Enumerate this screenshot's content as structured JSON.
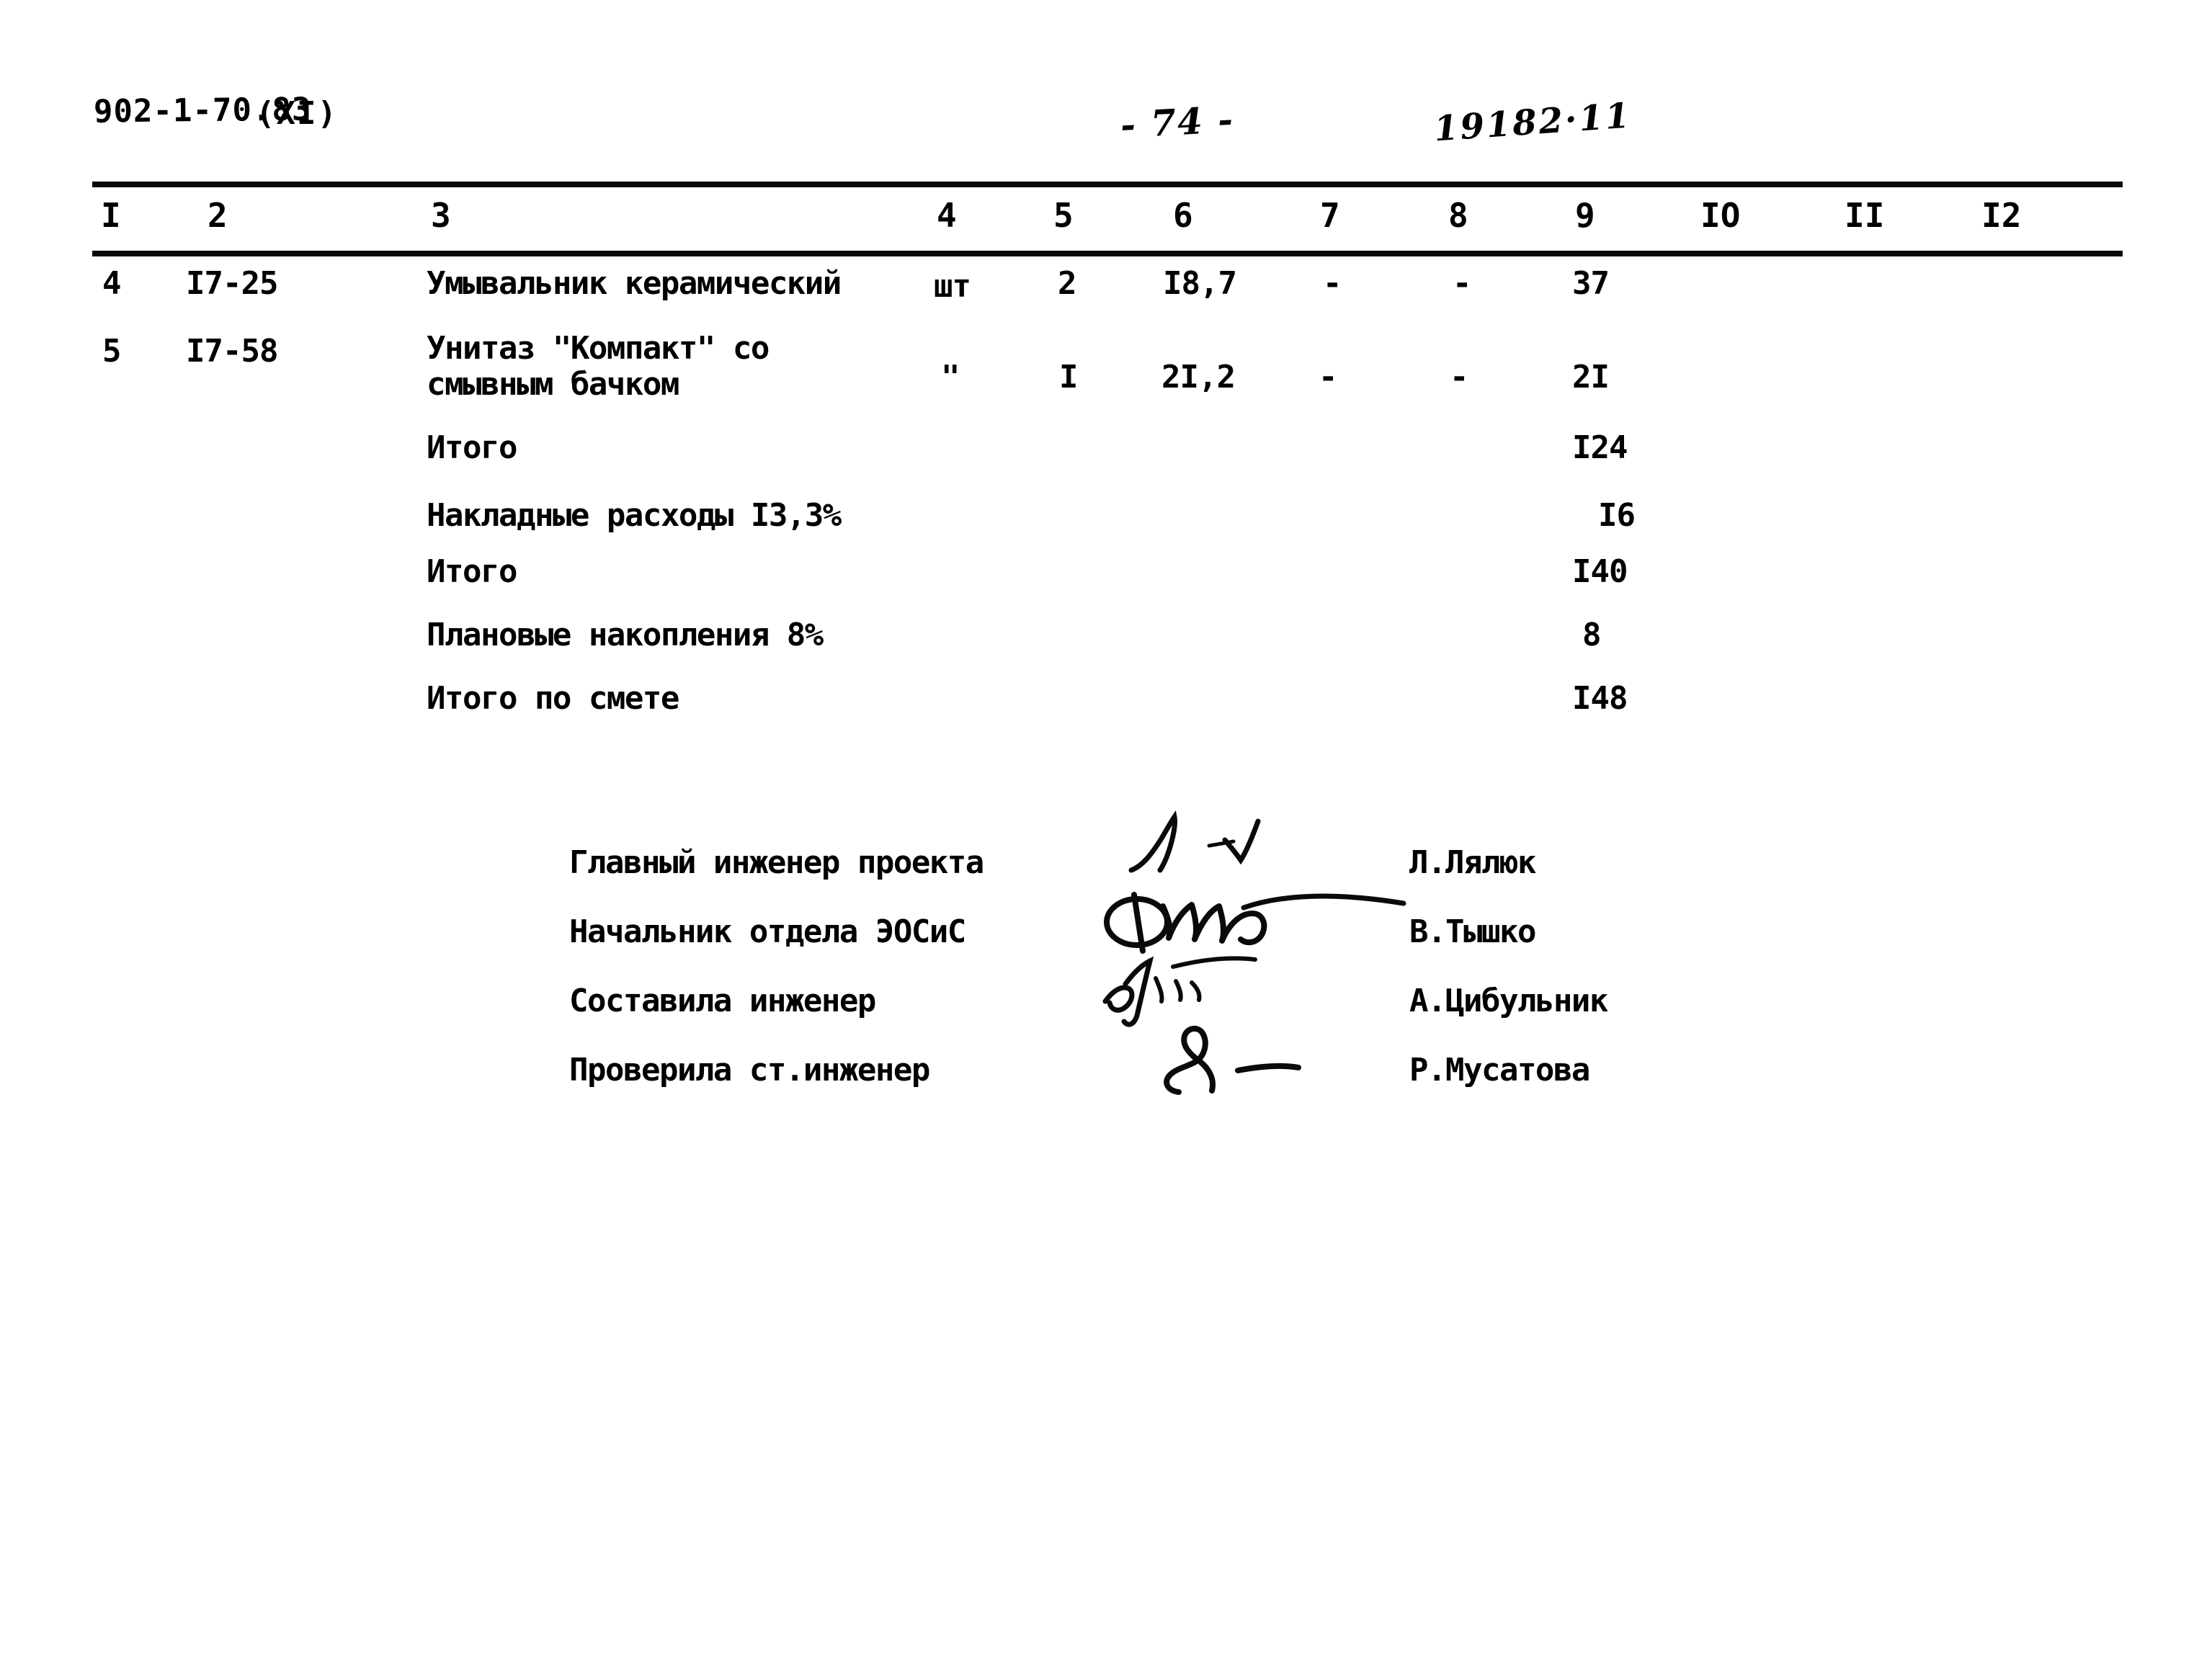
{
  "header": {
    "doc_code": "902-1-70.83",
    "doc_series": "(XI)",
    "page_number": "- 74 -",
    "reference_number": "19182·11"
  },
  "table": {
    "column_headers": [
      "I",
      "2",
      "3",
      "4",
      "5",
      "6",
      "7",
      "8",
      "9",
      "IO",
      "II",
      "I2"
    ],
    "rows": [
      {
        "num": "4",
        "code": "I7-25",
        "description_line1": "Умывальник керамический",
        "description_line2": "",
        "unit": "шт",
        "qty": "2",
        "price": "I8,7",
        "col7": "-",
        "col8": "-",
        "total": "37",
        "col10": "",
        "col11": "",
        "col12": ""
      },
      {
        "num": "5",
        "code": "I7-58",
        "description_line1": "Унитаз \"Компакт\" со",
        "description_line2": "смывным бачком",
        "unit": "\"",
        "qty": "I",
        "price": "2I,2",
        "col7": "-",
        "col8": "-",
        "total": "2I",
        "col10": "",
        "col11": "",
        "col12": ""
      }
    ],
    "summary": [
      {
        "label": "Итого",
        "value": "I24"
      },
      {
        "label": "Накладные расходы I3,3%",
        "value": "I6"
      },
      {
        "label": "Итого",
        "value": "I40"
      },
      {
        "label": "Плановые накопления 8%",
        "value": "8"
      },
      {
        "label": "Итого по смете",
        "value": "I48"
      }
    ]
  },
  "signatures": [
    {
      "role": "Главный инженер проекта",
      "name": "Л.Лялюк",
      "mark": "signature-mark-1"
    },
    {
      "role": "Начальник отдела ЭОСиС",
      "name": "В.Тышко",
      "mark": "signature-mark-2"
    },
    {
      "role": "Составила инженер",
      "name": "А.Цибульник",
      "mark": "signature-mark-3"
    },
    {
      "role": "Проверила ст.инженер",
      "name": "Р.Мусатова",
      "mark": "signature-mark-4"
    }
  ],
  "colors": {
    "ink": "#0a0a0a",
    "paper": "#ffffff"
  }
}
